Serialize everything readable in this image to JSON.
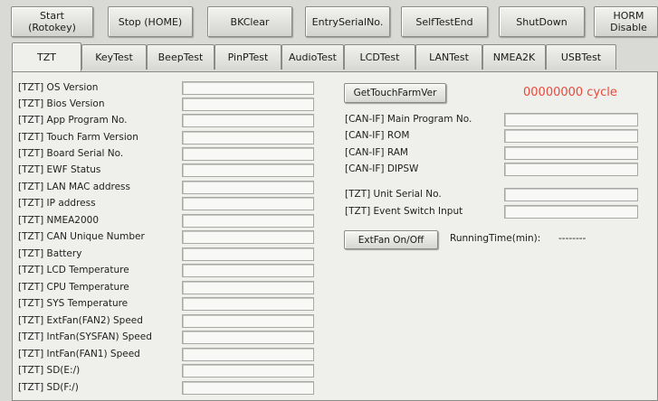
{
  "toolbar": {
    "buttons": [
      {
        "label": "Start\n(Rotokey)"
      },
      {
        "label": "Stop (HOME)"
      },
      {
        "label": "BKClear"
      },
      {
        "label": "EntrySerialNo."
      },
      {
        "label": "SelfTestEnd"
      },
      {
        "label": "ShutDown"
      },
      {
        "label": "HORM Disable"
      }
    ]
  },
  "tabs": [
    {
      "label": "TZT",
      "active": true
    },
    {
      "label": "KeyTest"
    },
    {
      "label": "BeepTest"
    },
    {
      "label": "PinPTest"
    },
    {
      "label": "AudioTest"
    },
    {
      "label": "LCDTest"
    },
    {
      "label": "LANTest"
    },
    {
      "label": "NMEA2K"
    },
    {
      "label": "USBTest"
    }
  ],
  "left_fields": [
    {
      "label": "[TZT] OS Version",
      "value": ""
    },
    {
      "label": "[TZT] Bios Version",
      "value": ""
    },
    {
      "label": "[TZT] App Program No.",
      "value": ""
    },
    {
      "label": "[TZT] Touch Farm Version",
      "value": ""
    },
    {
      "label": "[TZT] Board Serial No.",
      "value": ""
    },
    {
      "label": "[TZT] EWF Status",
      "value": ""
    },
    {
      "label": "[TZT] LAN MAC address",
      "value": ""
    },
    {
      "label": "[TZT] IP address",
      "value": ""
    },
    {
      "label": "[TZT] NMEA2000",
      "value": ""
    },
    {
      "label": "[TZT] CAN Unique Number",
      "value": ""
    },
    {
      "label": "[TZT] Battery",
      "value": ""
    },
    {
      "label": "[TZT] LCD Temperature",
      "value": ""
    },
    {
      "label": "[TZT] CPU Temperature",
      "value": ""
    },
    {
      "label": "[TZT] SYS Temperature",
      "value": ""
    },
    {
      "label": "[TZT] ExtFan(FAN2) Speed",
      "value": ""
    },
    {
      "label": "[TZT] IntFan(SYSFAN) Speed",
      "value": ""
    },
    {
      "label": "[TZT] IntFan(FAN1) Speed",
      "value": ""
    },
    {
      "label": "[TZT] SD(E:/)",
      "value": ""
    },
    {
      "label": "[TZT] SD(F:/)",
      "value": ""
    }
  ],
  "right": {
    "get_touch_button": "GetTouchFarmVer",
    "cycle_text": "00000000 cycle",
    "cycle_color": "#e84a3c",
    "can_fields": [
      {
        "label": "[CAN-IF] Main Program No.",
        "value": ""
      },
      {
        "label": "[CAN-IF] ROM",
        "value": ""
      },
      {
        "label": "[CAN-IF] RAM",
        "value": ""
      },
      {
        "label": "[CAN-IF] DIPSW",
        "value": ""
      }
    ],
    "tzt_fields": [
      {
        "label": "[TZT] Unit Serial No.",
        "value": ""
      },
      {
        "label": "[TZT] Event Switch Input",
        "value": ""
      }
    ],
    "extfan_button": "ExtFan On/Off",
    "running_time_label": "RunningTime(min):",
    "running_time_value": "--------"
  }
}
